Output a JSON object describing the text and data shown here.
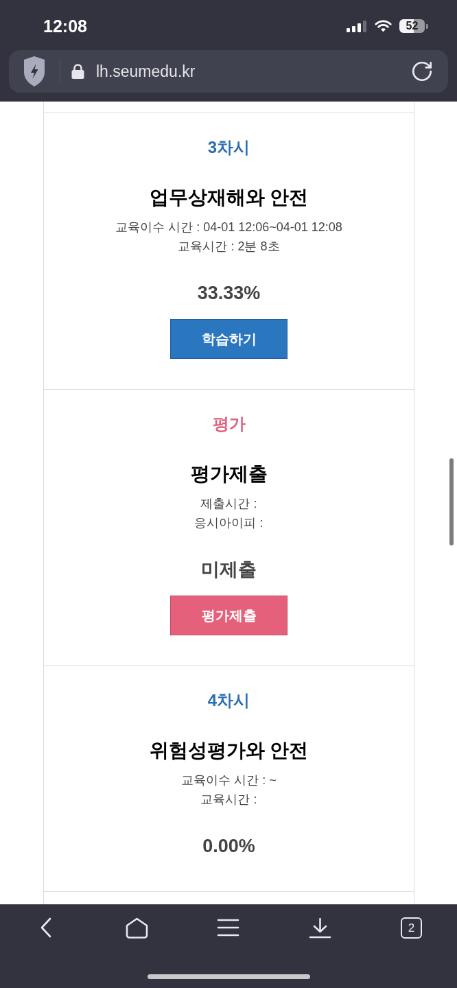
{
  "status_bar": {
    "time": "12:08",
    "battery": "52"
  },
  "address_bar": {
    "url": "lh.seumedu.kr"
  },
  "cards": [
    {
      "kind": "lesson",
      "label": "3차시",
      "title": "업무상재해와 안전",
      "details": [
        "교육이수 시간 : 04-01 12:06~04-01 12:08",
        "교육시간 : 2분 8초"
      ],
      "result": "33.33%",
      "button": "학습하기"
    },
    {
      "kind": "exam",
      "label": "평가",
      "title": "평가제출",
      "details": [
        "제출시간 :",
        "응시아이피 :"
      ],
      "result": "미제출",
      "button": "평가제출"
    },
    {
      "kind": "lesson",
      "label": "4차시",
      "title": "위험성평가와 안전",
      "details": [
        "교육이수 시간 : ~",
        "교육시간 :"
      ],
      "result": "0.00%"
    }
  ],
  "toolbar": {
    "tab_count": "2"
  }
}
